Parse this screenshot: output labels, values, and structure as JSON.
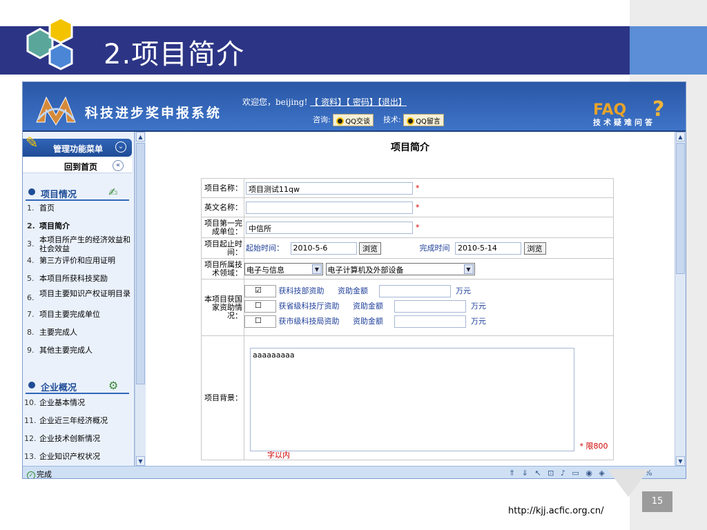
{
  "slide": {
    "title": "2.项目简介",
    "footer_url": "http://kjj.acfic.org.cn/",
    "page_number": "15"
  },
  "app": {
    "name": "科技进步奖申报系统",
    "welcome_prefix": "欢迎您，beijing!",
    "links": [
      "【 资料】",
      "【 密码】",
      "【退出】"
    ],
    "consult_label": "咨询:",
    "qq_chat": "QQ交谈",
    "tech_label": "技术:",
    "qq_msg": "QQ留言",
    "faq": "FAQ",
    "faq_sub": "技术疑难问答",
    "faq_mark": "?"
  },
  "sidebar": {
    "menu_title": "管理功能菜单",
    "menu_toggle": "⌄",
    "home_label": "回到首页",
    "home_toggle": "«",
    "sections": [
      {
        "title": "项目情况",
        "items": [
          {
            "num": "1.",
            "label": "首页"
          },
          {
            "num": "2.",
            "label": "项目简介"
          },
          {
            "num": "3.",
            "label": "本项目所产生的经济效益和社会效益"
          },
          {
            "num": "4.",
            "label": "第三方评价和应用证明"
          },
          {
            "num": "5.",
            "label": "本项目所获科技奖励"
          },
          {
            "num": "6.",
            "label": "项目主要知识产权证明目录"
          },
          {
            "num": "7.",
            "label": "项目主要完成单位"
          },
          {
            "num": "8.",
            "label": "主要完成人"
          },
          {
            "num": "9.",
            "label": "其他主要完成人"
          }
        ]
      },
      {
        "title": "企业概况",
        "items": [
          {
            "num": "10.",
            "label": "企业基本情况"
          },
          {
            "num": "11.",
            "label": "企业近三年经济概况"
          },
          {
            "num": "12.",
            "label": "企业技术创新情况"
          },
          {
            "num": "13.",
            "label": "企业知识产权状况"
          }
        ]
      }
    ]
  },
  "form": {
    "heading": "项目简介",
    "name_label": "项目名称：",
    "name_value": "项目测试11qw",
    "en_name_label": "英文名称：",
    "en_name_value": "",
    "unit_label": "项目第一完成单位：",
    "unit_value": "中信所",
    "period_label": "项目起止时间：",
    "start_label": "起始时间：",
    "start_value": "2010-5-6",
    "browse": "浏览",
    "end_label": "完成时间",
    "end_value": "2010-5-14",
    "field_label": "项目所属技术领域：",
    "field_main": "电子与信息",
    "field_sub": "电子计算机及外部设备",
    "funding_label": "本项目获国家资助情况：",
    "funding": [
      {
        "check": "☑",
        "source": "获科技部资助",
        "amount_label": "资助金额",
        "unit": "万元"
      },
      {
        "check": "☐",
        "source": "获省级科技厅资助",
        "amount_label": "资助金额",
        "unit": "万元"
      },
      {
        "check": "☐",
        "source": "获市级科技局资助",
        "amount_label": "资助金额",
        "unit": "万元"
      }
    ],
    "bg_label": "项目背景：",
    "bg_value": "aaaaaaaaa",
    "limit_note": "* 限800",
    "limit_tail": "字以内",
    "required_mark": "*"
  },
  "status": {
    "done": "完成",
    "zoom": "100%"
  },
  "colors": {
    "title_bar": "#2c3585",
    "app_header": "#2a57a6",
    "required": "#d00000"
  }
}
